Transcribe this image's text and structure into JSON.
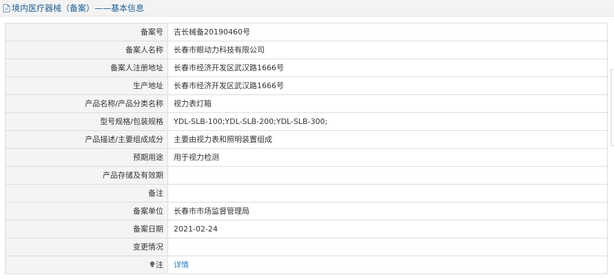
{
  "header": {
    "title": "境内医疗器械（备案）——基本信息",
    "icon": "document-icon"
  },
  "rows": [
    {
      "label": "备案号",
      "value": "吉长械备20190460号"
    },
    {
      "label": "备案人名称",
      "value": "长春市眼动力科技有限公司"
    },
    {
      "label": "备案人注册地址",
      "value": "长春市经济开发区武汉路1666号"
    },
    {
      "label": "生产地址",
      "value": "长春市经济开发区武汉路1666号"
    },
    {
      "label": "产品名称/产品分类名称",
      "value": "视力表灯箱"
    },
    {
      "label": "型号规格/包装规格",
      "value": "YDL-SLB-100;YDL-SLB-200;YDL-SLB-300;"
    },
    {
      "label": "产品描述/主要组成成分",
      "value": "主要由视力表和照明装置组成"
    },
    {
      "label": "预期用途",
      "value": "用于视力检测"
    },
    {
      "label": "产品存储及有效期",
      "value": ""
    },
    {
      "label": "备注",
      "value": ""
    },
    {
      "label": "备案单位",
      "value": "长春市市场监督管理局"
    },
    {
      "label": "备案日期",
      "value": "2021-02-24"
    },
    {
      "label": "变更情况",
      "value": ""
    }
  ],
  "note_row": {
    "label": "注",
    "link_text": "详情",
    "icon": "lightbulb-icon"
  },
  "colors": {
    "title": "#1f5d8f",
    "link": "#2d7cc3",
    "label_bg": "#f4f4f4",
    "border": "#dcdcdc"
  }
}
